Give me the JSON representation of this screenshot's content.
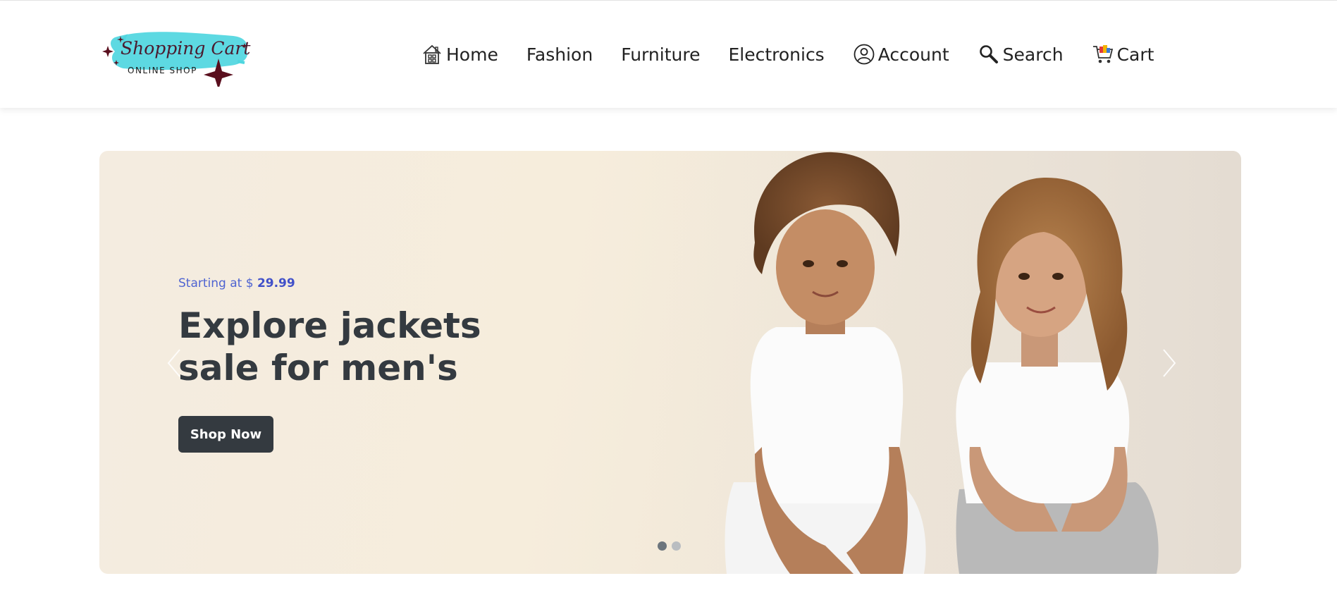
{
  "brand": {
    "logo_script_text": "Shopping Cart",
    "logo_sub_text": "ONLINE SHOP",
    "accent_color": "#4fd6df",
    "star_color": "#5a0f1e"
  },
  "nav": {
    "items": [
      {
        "label": "Home",
        "icon": "home-icon"
      },
      {
        "label": "Fashion"
      },
      {
        "label": "Furniture"
      },
      {
        "label": "Electronics"
      },
      {
        "label": "Account",
        "icon": "user-circle-icon"
      },
      {
        "label": "Search",
        "icon": "search-icon"
      },
      {
        "label": "Cart",
        "icon": "cart-icon"
      }
    ]
  },
  "hero": {
    "price_prefix": "Starting at $",
    "price_value": "29.99",
    "headline_line1": "Explore jackets",
    "headline_line2": "sale for men's",
    "cta_label": "Shop Now",
    "slide_count": 2,
    "active_slide": 1,
    "price_color": "#4f64d1",
    "button_color": "#343a40"
  }
}
